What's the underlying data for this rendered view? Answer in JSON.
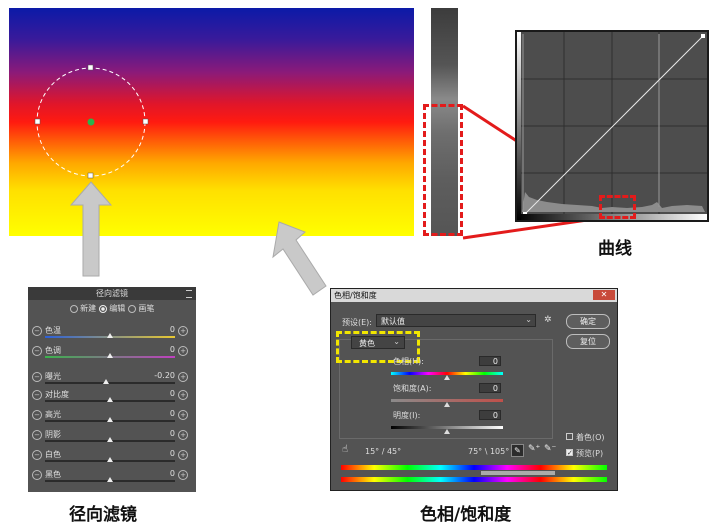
{
  "captions": {
    "curves": "曲线",
    "radial_filter": "径向滤镜",
    "hue_saturation": "色相/饱和度"
  },
  "radial_panel": {
    "title": "径向滤镜",
    "mode_new": "新建",
    "mode_edit": "编辑",
    "mode_brush": "画笔",
    "rows": [
      {
        "label": "色温",
        "value": "0",
        "level": 0.5
      },
      {
        "label": "色调",
        "value": "0",
        "level": 0.5
      },
      {
        "label": "曝光",
        "value": "-0.20",
        "level": 0.47
      },
      {
        "label": "对比度",
        "value": "0",
        "level": 0.5
      },
      {
        "label": "高光",
        "value": "0",
        "level": 0.5
      },
      {
        "label": "阴影",
        "value": "0",
        "level": 0.5
      },
      {
        "label": "白色",
        "value": "0",
        "level": 0.5
      },
      {
        "label": "黑色",
        "value": "0",
        "level": 0.5
      }
    ]
  },
  "hue_sat_dialog": {
    "title": "色相/饱和度",
    "close": "✕",
    "preset_label": "预设(E):",
    "preset_value": "默认值",
    "ok": "确定",
    "reset": "复位",
    "channel": "黄色",
    "hue_label": "色相(H):",
    "hue_value": "0",
    "sat_label": "饱和度(A):",
    "sat_value": "0",
    "light_label": "明度(I):",
    "light_value": "0",
    "range_left": "15° / 45°",
    "range_right": "75° \\ 105°",
    "colorize": "着色(O)",
    "preview": "预览(P)"
  },
  "colors": {
    "annotation_red": "#e31b1b",
    "annotation_yellow": "#f2e600",
    "arrow_gray": "#c9c9c9"
  }
}
